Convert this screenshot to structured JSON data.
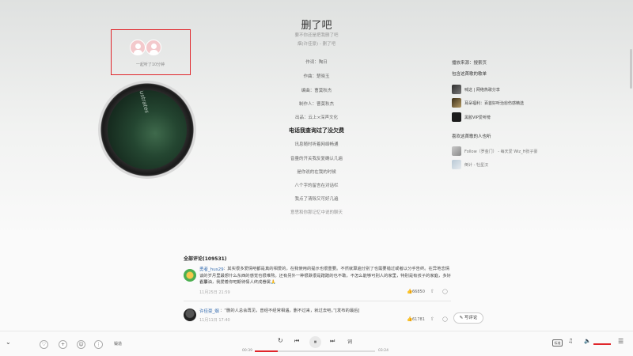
{
  "colors": {
    "accent": "#e0262b",
    "link": "#3a6fb0"
  },
  "listeners": {
    "text": "一起听了10分钟"
  },
  "cover": {
    "art_text": "Illustrates"
  },
  "song": {
    "title": "删了吧",
    "subtitle": "要不你还是把我删了吧",
    "artist_line": "烟(许佳豪) - 删了吧"
  },
  "lyrics": [
    "作词：陶日",
    "作曲：楚晓玉",
    "编曲：曹莫秋杰",
    "制作人：曹莫秋杰",
    "出品：云上×深声文化",
    "电话我查询过了没欠费",
    "讯息随时听着网络畅通",
    "音量的开关我反复确认几遍",
    "是你说的在我的时候",
    "八个字的留言在对话栏",
    "我点了清除又可好几遍",
    "意思和你那记忆中说的聊天"
  ],
  "current_lyric_index": 5,
  "right_panel": {
    "source": "播放来源：搜索页",
    "playlists_title": "包含这首歌的歌单",
    "playlists": [
      {
        "name": "喊这 | 网络热歌分享",
        "icon": "playlist-cover-icon"
      },
      {
        "name": "耳朵福利：百首好听治愈伤感精选",
        "icon": "playlist-cover-icon"
      },
      {
        "name": "黑胶VIP爱听榜",
        "icon": "playlist-cover-icon"
      }
    ],
    "likers_title": "喜欢这首歌的人也听",
    "likers": [
      {
        "name": "Follow（罗金门） - 每天爱 Wiz_H张子豪"
      },
      {
        "name": "倒计 - 牡星汉"
      }
    ]
  },
  "comments": {
    "title": "全部评论(109531)",
    "items": [
      {
        "user": "勇者_hus29",
        "text1": "：其实很多爱情吧都是真的相爱的，在我使用的提示也很重要。不然就算遍分别了也需要错过或者以分手告终。在异地恋情",
        "text2": "谈的岁月里最想什么东西的感觉也很难熬。还有另外一种很跌很是蹭蹭的也不敢，不怎么能够可别人的家里，特别是有孩子的家庭，多好看事",
        "text3": "，加油，我爱着你吧期待情人终成眷属🙏",
        "time": "11月25日 21:59",
        "likes": "66850"
      },
      {
        "user": "许佳豪_烟",
        "text1": "：“删的人总会再见，曾经不经常相遇，删不过来，就过去吧。”[发布的最后]",
        "time": "11月11日 17:40",
        "likes": "61781"
      }
    ],
    "write_label": "写评论"
  },
  "player": {
    "lyric_btn": "词",
    "buzz_btn": "锻造",
    "time_current": "00:39",
    "time_total": "03:24",
    "progress": 0.19,
    "quality_badge": "标准"
  }
}
